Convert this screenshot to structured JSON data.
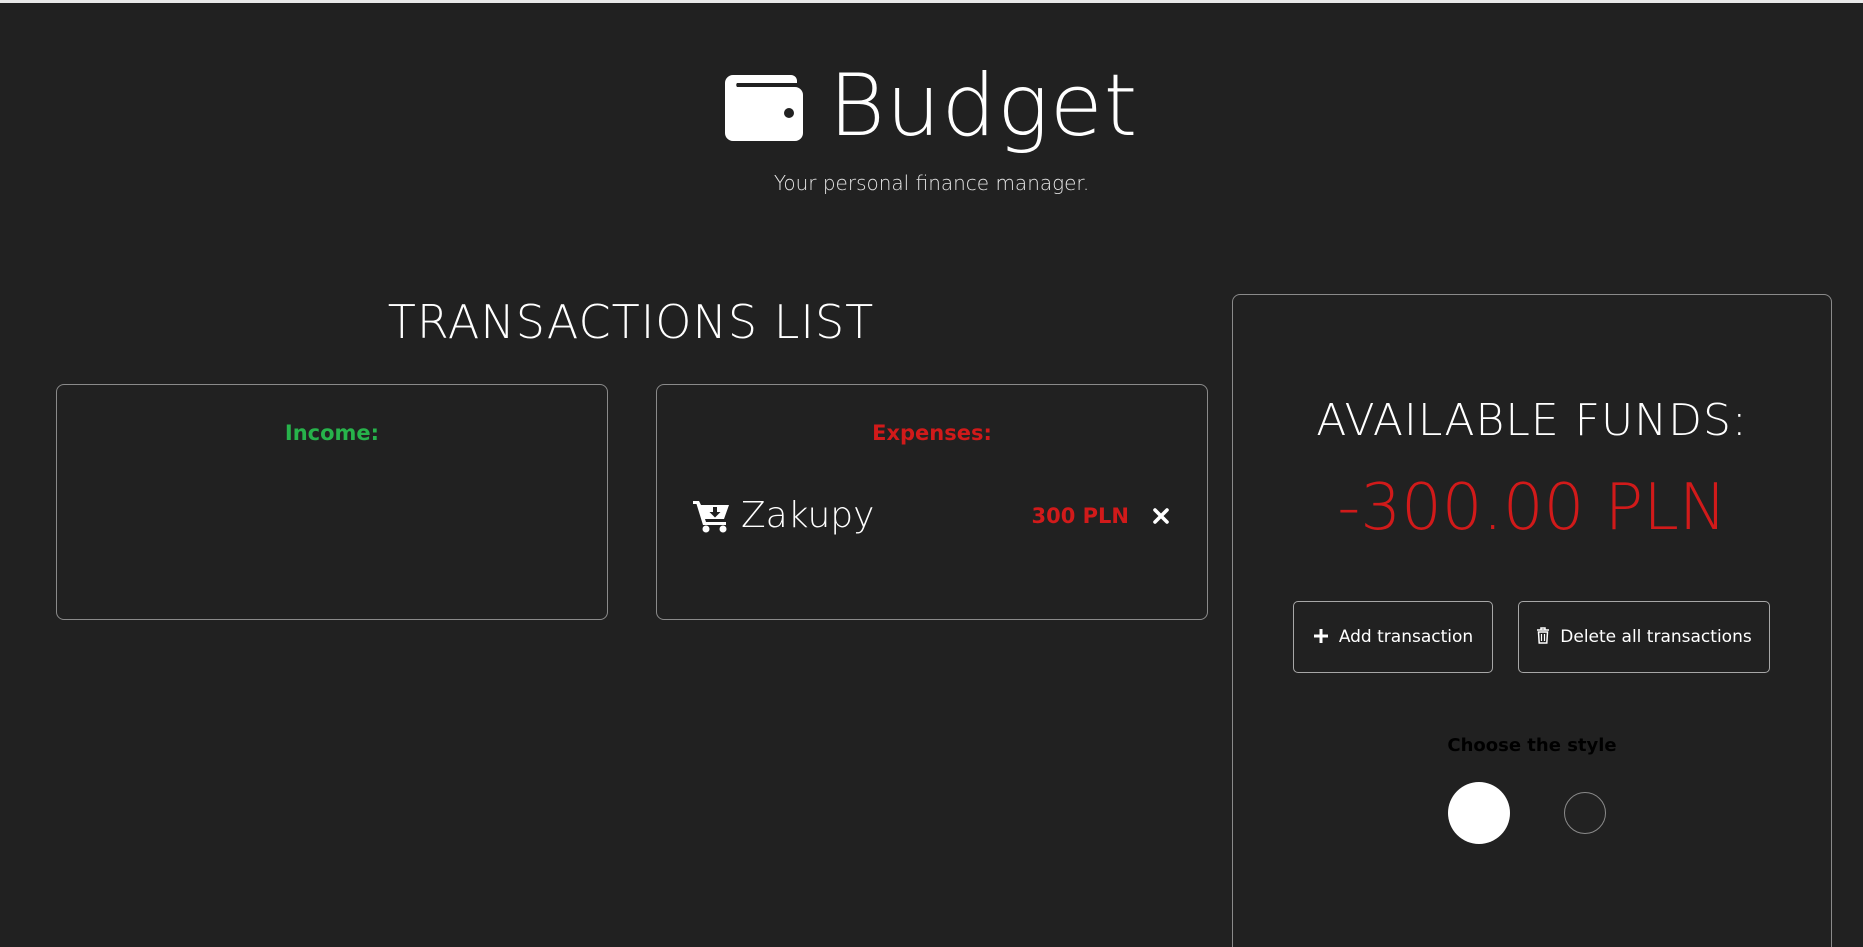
{
  "header": {
    "title": "Budget",
    "subtitle": "Your personal finance manager.",
    "icon": "wallet-icon"
  },
  "transactions": {
    "title": "TRANSACTIONS LIST",
    "income": {
      "label": "Income:",
      "items": []
    },
    "expenses": {
      "label": "Expenses:",
      "items": [
        {
          "icon": "cart-download-icon",
          "name": "Zakupy",
          "amount": "300 PLN"
        }
      ]
    }
  },
  "funds": {
    "label": "AVAILABLE FUNDS:",
    "value": "-300.00 PLN"
  },
  "actions": {
    "add_label": "Add transaction",
    "delete_all_label": "Delete all transactions"
  },
  "style_chooser": {
    "label": "Choose the style",
    "options": [
      "light",
      "dark"
    ]
  },
  "colors": {
    "background": "#212121",
    "income": "#27b34b",
    "expense": "#d11a1a",
    "border": "#8a8a8a"
  }
}
